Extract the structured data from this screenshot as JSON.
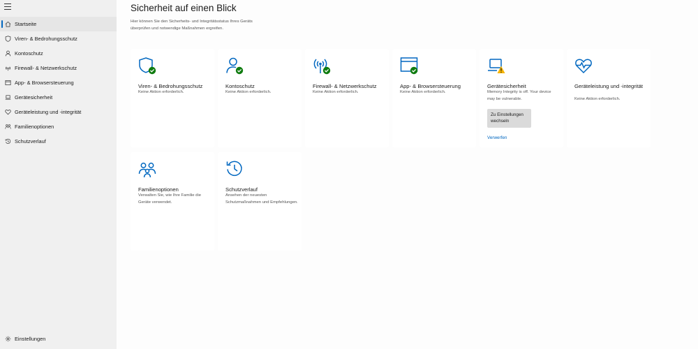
{
  "sidebar": {
    "menu_icon": "hamburger-icon",
    "items": [
      {
        "label": "Startseite",
        "icon": "home-icon",
        "active": true
      },
      {
        "label": "Viren- & Bedrohungsschutz",
        "icon": "shield-icon"
      },
      {
        "label": "Kontoschutz",
        "icon": "person-icon"
      },
      {
        "label": "Firewall- & Netzwerkschutz",
        "icon": "wifi-icon"
      },
      {
        "label": "App- & Browsersteuerung",
        "icon": "browser-icon"
      },
      {
        "label": "Gerätesicherheit",
        "icon": "laptop-icon"
      },
      {
        "label": "Geräteleistung und -integrität",
        "icon": "heart-icon"
      },
      {
        "label": "Familienoptionen",
        "icon": "family-icon"
      },
      {
        "label": "Schutzverlauf",
        "icon": "history-icon"
      }
    ],
    "settings_label": "Einstellungen"
  },
  "main": {
    "title": "Sicherheit auf einen Blick",
    "description": "Hier können Sie den Sicherheits- und Integritätsstatus Ihres Geräts überprüfen und notwendige Maßnahmen ergreifen.",
    "cards": [
      {
        "title": "Viren- & Bedrohungsschutz",
        "status": "Keine Aktion erforderlich.",
        "icon": "shield-check-icon"
      },
      {
        "title": "Kontoschutz",
        "status": "Keine Aktion erforderlich.",
        "icon": "account-check-icon"
      },
      {
        "title": "Firewall- & Netzwerkschutz",
        "status": "Keine Aktion erforderlich.",
        "icon": "network-check-icon"
      },
      {
        "title": "App- & Browsersteuerung",
        "status": "Keine Aktion erforderlich.",
        "icon": "browser-check-icon"
      },
      {
        "title": "Gerätesicherheit",
        "status": "Memory Integrity is off. Your device may be vulnerable.",
        "icon": "laptop-warning-icon",
        "button": "Zu Einstellungen wechseln",
        "link": "Verwerfen"
      },
      {
        "title": "Geräteleistung und -integrität",
        "status": "Keine Aktion erforderlich.",
        "icon": "heart-pulse-icon"
      },
      {
        "title": "Familienoptionen",
        "status": "Verwalten Sie, wie Ihre Familie die Geräte verwendet.",
        "icon": "family-icon"
      },
      {
        "title": "Schutzverlauf",
        "status": "Ansehen der neuesten Schutzmaßnahmen und Empfehlungen.",
        "icon": "history-icon"
      }
    ]
  },
  "colors": {
    "accent": "#0067c0",
    "success": "#107c10",
    "warning": "#f7b500",
    "sidebar_bg": "#f0f0f0"
  }
}
